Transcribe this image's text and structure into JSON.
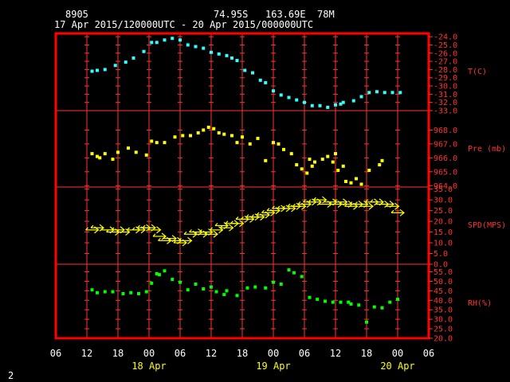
{
  "header": {
    "station": "8905",
    "lat": "74.95S",
    "lon": "163.69E",
    "elev": "78M",
    "period": "17 Apr 2015/120000UTC - 20 Apr 2015/000000UTC"
  },
  "corner_label": "2",
  "colors": {
    "frame": "#ff0000",
    "grid": "#ff3333",
    "temp": "#33ffff",
    "pres": "#ffff00",
    "wind": "#ffff00",
    "rh": "#00ff00",
    "text": "#ffffff",
    "axis_text": "#ff3333",
    "date_text": "#ffff00"
  },
  "chart_data": {
    "type": "scatter",
    "x_unit": "hours since 17 Apr 2015 06 UTC",
    "xlim": [
      0,
      72
    ],
    "x_ticks": [
      "06",
      "12",
      "18",
      "00",
      "06",
      "12",
      "18",
      "00",
      "06",
      "12",
      "18",
      "00",
      "06"
    ],
    "date_labels": [
      {
        "label": "18 Apr",
        "x": 18
      },
      {
        "label": "19 Apr",
        "x": 42
      },
      {
        "label": "20 Apr",
        "x": 66
      }
    ],
    "panels": [
      {
        "name": "temperature",
        "ylabel": "T(C)",
        "ylim": [
          -33,
          -23.6
        ],
        "ticks": [
          -24,
          -25,
          -26,
          -27,
          -28,
          -29,
          -30,
          -31,
          -32,
          -33
        ],
        "tick_labels": [
          "-24.0",
          "-25.0",
          "-26.0",
          "-27.0",
          "-28.0",
          "-29.0",
          "-30.0",
          "-31.0",
          "-32.0",
          "-33.0"
        ],
        "series": {
          "x": [
            7,
            8,
            9.5,
            11.5,
            13.5,
            15,
            17,
            18.5,
            19.5,
            21,
            22.5,
            24,
            25.5,
            27,
            28.5,
            30,
            31.5,
            33,
            34,
            35,
            36.5,
            38,
            39.5,
            40.5,
            42,
            43.5,
            45,
            46.5,
            48,
            49.5,
            51,
            52.5,
            54,
            55,
            55.5,
            57.5,
            59,
            60.5,
            62,
            63.5,
            65,
            66.5
          ],
          "y": [
            -28.2,
            -28.1,
            -28.0,
            -27.5,
            -27.1,
            -26.6,
            -25.8,
            -24.7,
            -24.7,
            -24.4,
            -24.2,
            -24.4,
            -25.0,
            -25.2,
            -25.4,
            -25.9,
            -26.1,
            -26.3,
            -26.6,
            -26.9,
            -28.1,
            -28.4,
            -29.3,
            -29.6,
            -30.6,
            -31.1,
            -31.4,
            -31.7,
            -32.0,
            -32.4,
            -32.4,
            -32.6,
            -32.3,
            -32.2,
            -32.0,
            -31.8,
            -31.3,
            -30.8,
            -30.7,
            -30.8,
            -30.8,
            -30.8
          ]
        }
      },
      {
        "name": "pressure",
        "ylabel": "Pre (mb)",
        "ylim": [
          963.9,
          969.4
        ],
        "ticks": [
          968,
          967,
          966,
          965,
          964
        ],
        "tick_labels": [
          "968.0",
          "967.0",
          "966.0",
          "965.0",
          "964.0"
        ],
        "series": {
          "x": [
            7,
            8,
            8.5,
            9.5,
            11,
            12,
            14,
            15.5,
            17.5,
            18.5,
            19.5,
            21,
            23,
            24.5,
            26,
            27.5,
            28.5,
            29.5,
            30.5,
            31.5,
            32.5,
            34,
            35,
            36,
            37.5,
            39,
            40.5,
            42,
            43,
            44,
            45.5,
            46.5,
            47.5,
            48.5,
            49,
            49.5,
            50,
            51.5,
            52.5,
            53.5,
            54,
            54.5,
            55.5,
            56,
            57,
            58,
            59,
            60.5,
            62.5,
            63
          ],
          "y": [
            966.3,
            966.1,
            966.0,
            966.3,
            965.9,
            966.4,
            966.7,
            966.4,
            966.2,
            967.2,
            967.1,
            967.1,
            967.5,
            967.6,
            967.6,
            967.8,
            968.0,
            968.2,
            968.1,
            967.8,
            967.7,
            967.6,
            967.1,
            967.5,
            967.0,
            967.4,
            965.8,
            967.1,
            967.0,
            966.6,
            966.3,
            965.5,
            965.2,
            964.9,
            965.9,
            965.4,
            965.7,
            965.9,
            966.1,
            965.7,
            966.3,
            965.1,
            965.4,
            964.3,
            964.2,
            964.5,
            964.1,
            965.1,
            965.5,
            965.8
          ]
        }
      },
      {
        "name": "wind speed",
        "ylabel": "SPD(MPS)",
        "ylim": [
          0,
          36
        ],
        "ticks": [
          0,
          5,
          10,
          15,
          20,
          25,
          30,
          35
        ],
        "tick_labels": [
          "0.0",
          "5.0",
          "10.0",
          "15.0",
          "20.0",
          "25.0",
          "30.0",
          "35.0"
        ],
        "series": {
          "x": [
            7,
            8,
            10,
            11,
            12,
            13,
            15,
            16,
            17,
            18,
            19,
            20,
            21,
            22,
            23,
            24,
            25,
            26,
            27,
            28,
            29,
            30,
            31,
            32,
            33,
            34,
            35,
            36,
            37,
            38,
            39,
            40,
            41,
            42,
            43,
            44,
            45,
            46,
            47,
            48,
            49,
            50,
            51,
            52,
            53,
            54,
            55,
            56,
            57,
            58,
            59,
            60,
            61,
            62,
            63,
            64,
            65,
            66
          ],
          "y": [
            16,
            17,
            16,
            15,
            16,
            15,
            16,
            16,
            17,
            17,
            16,
            13,
            11,
            12,
            11,
            10,
            11,
            14,
            15,
            14,
            15,
            14,
            16,
            18,
            17,
            19,
            19,
            21,
            21,
            22,
            22,
            23,
            24,
            25,
            26,
            26,
            26,
            27,
            27,
            28,
            29,
            29,
            30,
            28,
            29,
            28,
            29,
            28,
            27,
            28,
            28,
            27,
            29,
            29,
            28,
            28,
            27,
            24
          ]
        }
      },
      {
        "name": "relative humidity",
        "ylabel": "RH(%)",
        "ylim": [
          20,
          59
        ],
        "ticks": [
          20,
          25,
          30,
          35,
          40,
          45,
          50,
          55
        ],
        "tick_labels": [
          "20.0",
          "25.0",
          "30.0",
          "35.0",
          "40.0",
          "45.0",
          "50.0",
          "55.0"
        ],
        "series": {
          "x": [
            7,
            8,
            9.5,
            11,
            13,
            14.5,
            16,
            17.5,
            18.5,
            19.5,
            20,
            21,
            22.5,
            24,
            25.5,
            27,
            28.5,
            30,
            31,
            32.5,
            33,
            35,
            37,
            38.5,
            40.5,
            42,
            43.5,
            45,
            46,
            47.5,
            49,
            50.5,
            52,
            53.5,
            55,
            56.5,
            57,
            58.5,
            60,
            61.5,
            63,
            64.5,
            66
          ],
          "y": [
            45.5,
            44,
            44.5,
            44.5,
            43.5,
            44,
            43.5,
            44.5,
            49,
            54,
            53.5,
            55.5,
            51,
            49.5,
            45.5,
            48.5,
            46,
            47,
            44.5,
            43,
            45,
            42.5,
            46.5,
            47,
            46.5,
            49.5,
            48.5,
            56,
            54.5,
            52.5,
            41.5,
            40.5,
            39.5,
            39,
            39,
            39,
            38,
            37.5,
            28.5,
            36.5,
            36,
            39,
            40.5
          ]
        }
      }
    ]
  }
}
